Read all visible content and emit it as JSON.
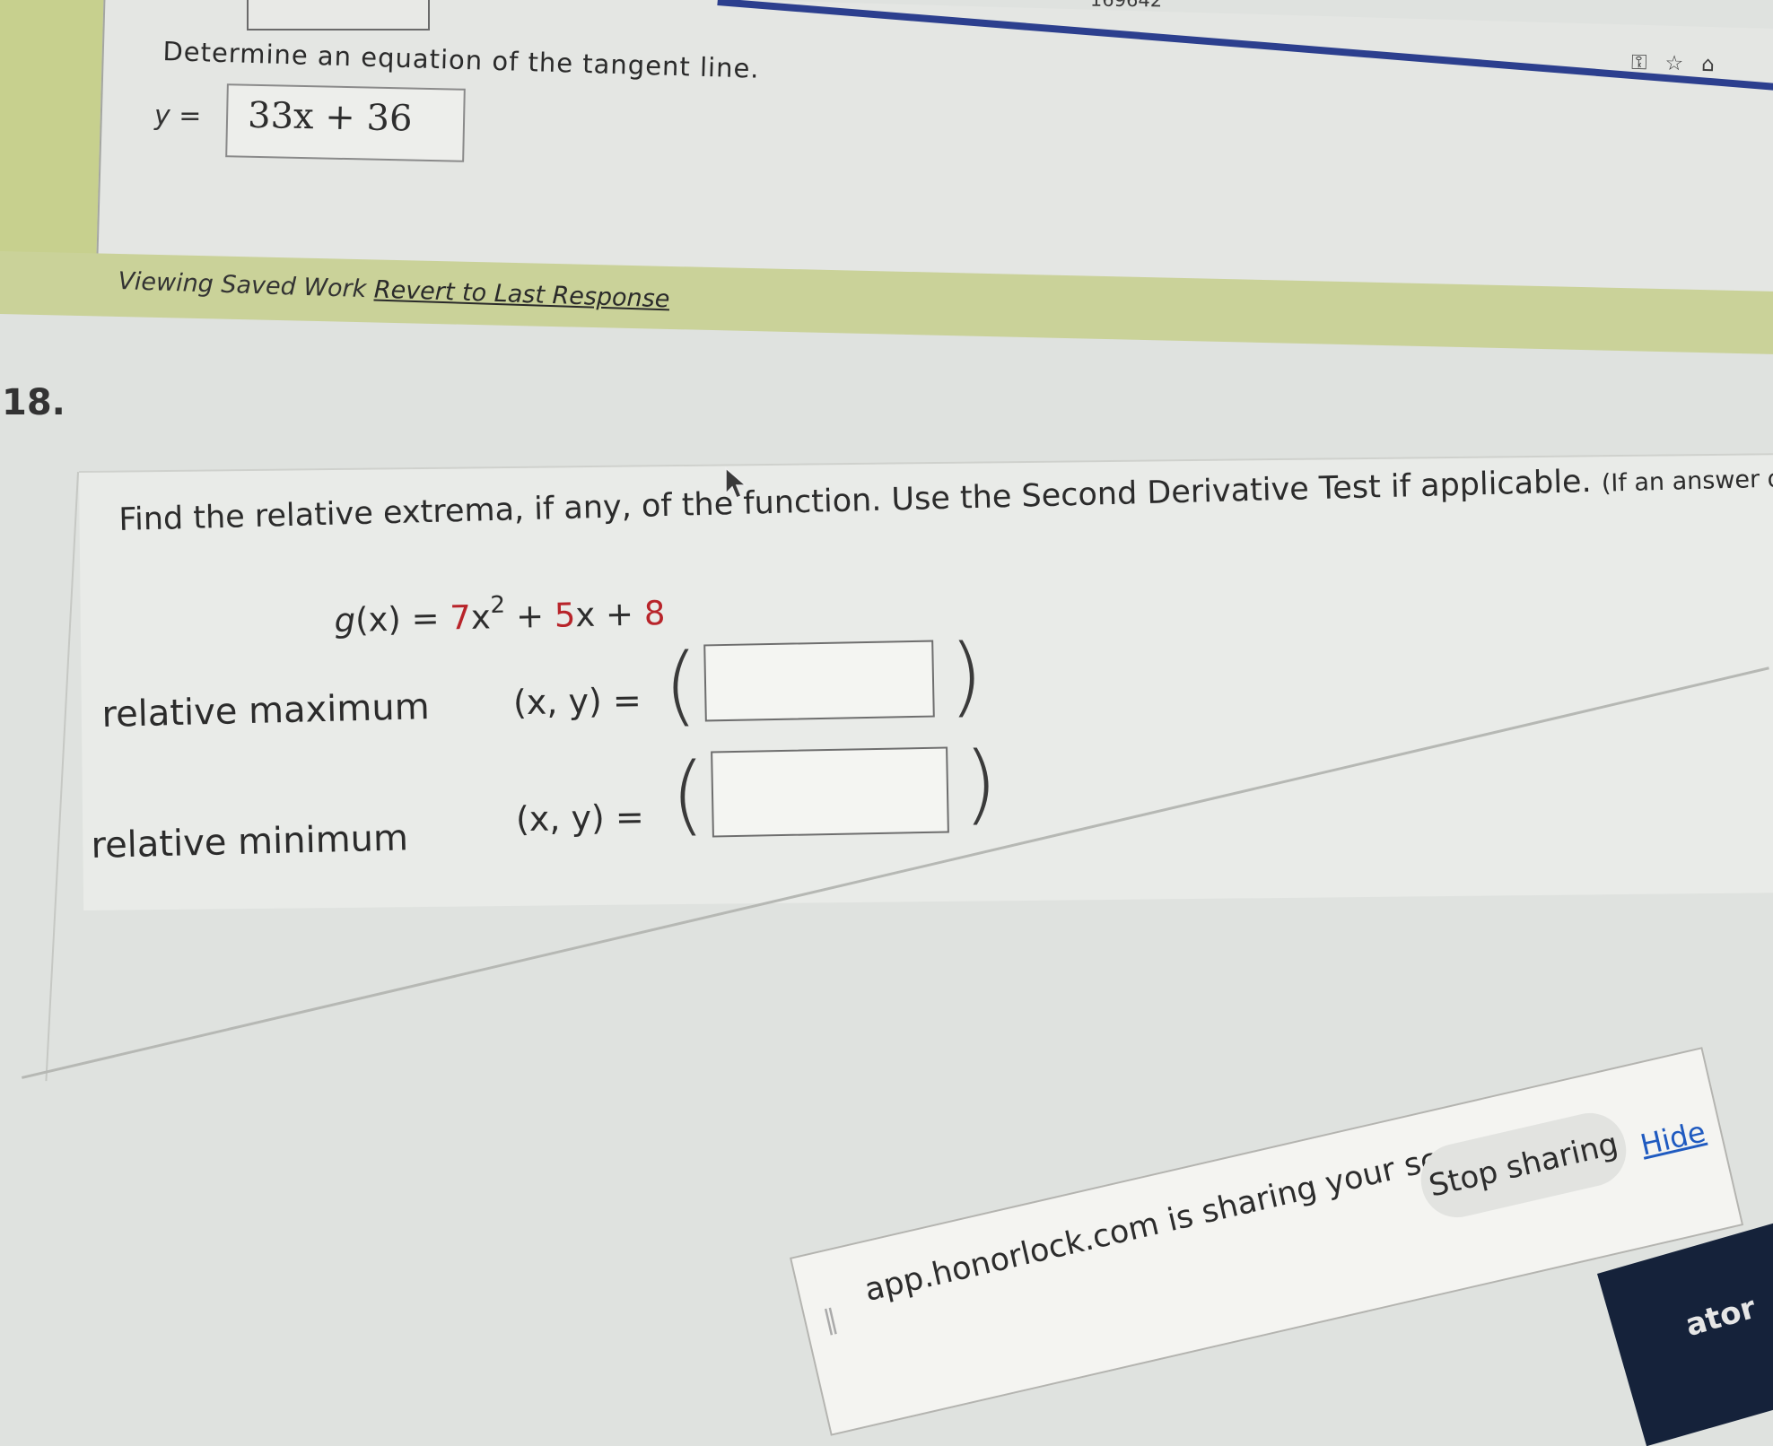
{
  "browser": {
    "url_fragment": "169642",
    "icons": [
      "key-icon",
      "star-icon",
      "home-icon"
    ]
  },
  "previous_question": {
    "prompt": "Determine an equation of the tangent line.",
    "y_label": "y =",
    "answer": "33x + 36",
    "saved_status": "Viewing Saved Work",
    "revert_link": "Revert to Last Response"
  },
  "question": {
    "number": "18.",
    "instructions_main": "Find the relative extrema, if any, of the function. Use the Second Derivative Test if applicable.",
    "instructions_note": "(If an answer does not exist, enter",
    "function": {
      "name": "g",
      "var": "x",
      "coef_a": "7",
      "exponent": "2",
      "coef_b": "5",
      "constant": "8"
    },
    "rows": [
      {
        "label": "relative maximum",
        "xy": "(x, y) =",
        "value": ""
      },
      {
        "label": "relative minimum",
        "xy": "(x, y) =",
        "value": ""
      }
    ]
  },
  "share_banner": {
    "message": "app.honorlock.com is sharing your screen.",
    "stop_label": "Stop sharing",
    "hide_label": "Hide",
    "corner_fragment": "ator"
  },
  "colors": {
    "saved_bar": "#cad299",
    "highlight_red": "#b8242a",
    "link_blue": "#1f5ac0",
    "browser_band": "#2c3f8e"
  }
}
